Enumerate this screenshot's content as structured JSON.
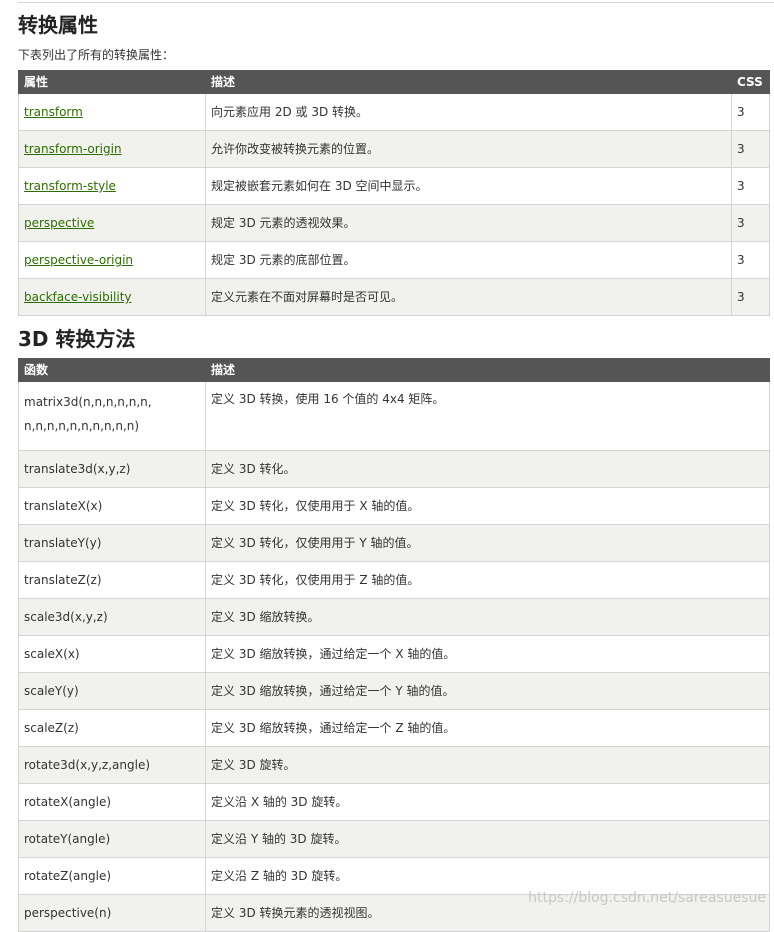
{
  "section1": {
    "title": "转换属性",
    "intro": "下表列出了所有的转换属性：",
    "headers": {
      "attr": "属性",
      "desc": "描述",
      "css": "CSS"
    },
    "rows": [
      {
        "name": "transform",
        "desc": "向元素应用 2D 或 3D 转换。",
        "css": "3"
      },
      {
        "name": "transform-origin",
        "desc": "允许你改变被转换元素的位置。",
        "css": "3"
      },
      {
        "name": "transform-style",
        "desc": "规定被嵌套元素如何在 3D 空间中显示。",
        "css": "3"
      },
      {
        "name": "perspective",
        "desc": "规定 3D 元素的透视效果。",
        "css": "3"
      },
      {
        "name": "perspective-origin",
        "desc": "规定 3D 元素的底部位置。",
        "css": "3"
      },
      {
        "name": "backface-visibility",
        "desc": "定义元素在不面对屏幕时是否可见。",
        "css": "3"
      }
    ]
  },
  "section2": {
    "title": "3D 转换方法",
    "headers": {
      "func": "函数",
      "desc": "描述"
    },
    "matrix_line1": "matrix3d(n,n,n,n,n,n,",
    "matrix_line2": "n,n,n,n,n,n,n,n,n,n)",
    "rows": [
      {
        "func": "matrix3d",
        "desc": "定义 3D 转换，使用 16 个值的 4x4 矩阵。"
      },
      {
        "func": "translate3d(x,y,z)",
        "desc": "定义 3D 转化。"
      },
      {
        "func": "translateX(x)",
        "desc": "定义 3D 转化，仅使用用于 X 轴的值。"
      },
      {
        "func": "translateY(y)",
        "desc": "定义 3D 转化，仅使用用于 Y 轴的值。"
      },
      {
        "func": "translateZ(z)",
        "desc": "定义 3D 转化，仅使用用于 Z 轴的值。"
      },
      {
        "func": "scale3d(x,y,z)",
        "desc": "定义 3D 缩放转换。"
      },
      {
        "func": "scaleX(x)",
        "desc": "定义 3D 缩放转换，通过给定一个 X 轴的值。"
      },
      {
        "func": "scaleY(y)",
        "desc": "定义 3D 缩放转换，通过给定一个 Y 轴的值。"
      },
      {
        "func": "scaleZ(z)",
        "desc": "定义 3D 缩放转换，通过给定一个 Z 轴的值。"
      },
      {
        "func": "rotate3d(x,y,z,angle)",
        "desc": "定义 3D 旋转。"
      },
      {
        "func": "rotateX(angle)",
        "desc": "定义沿 X 轴的 3D 旋转。"
      },
      {
        "func": "rotateY(angle)",
        "desc": "定义沿 Y 轴的 3D 旋转。"
      },
      {
        "func": "rotateZ(angle)",
        "desc": "定义沿 Z 轴的 3D 旋转。"
      },
      {
        "func": "perspective(n)",
        "desc": "定义 3D 转换元素的透视视图。"
      }
    ]
  },
  "watermark": "https://blog.csdn.net/sareasuesue",
  "colors": {
    "header_bg": "#555555",
    "alt_row_bg": "#f1f1ed",
    "link": "#2d6e00"
  }
}
